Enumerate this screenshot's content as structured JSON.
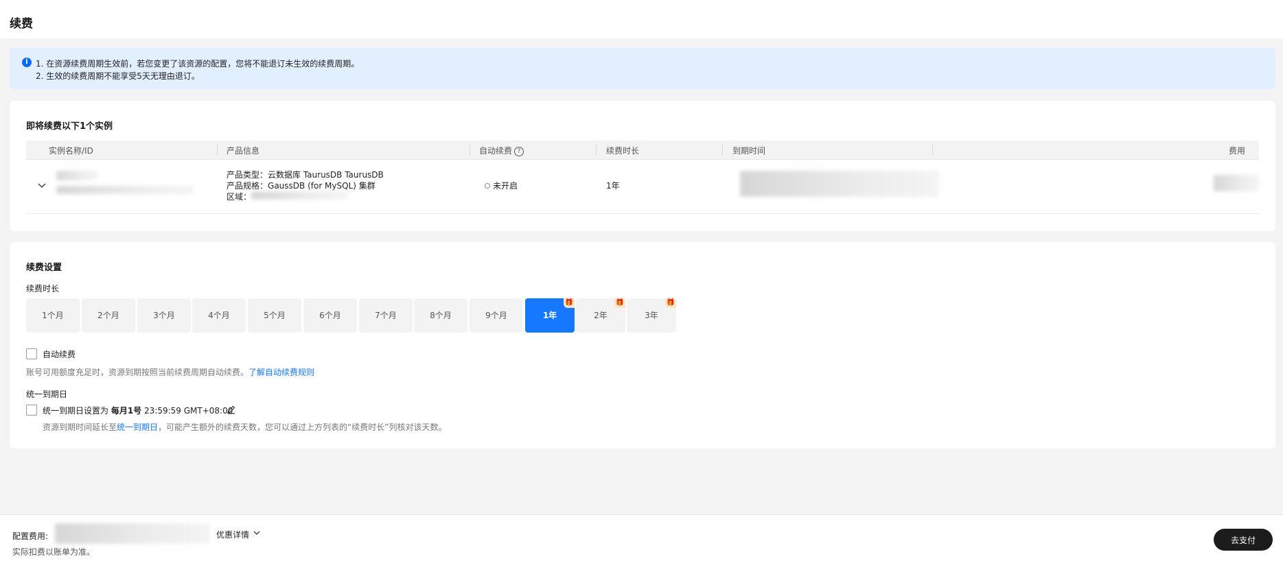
{
  "page": {
    "title": "续费"
  },
  "notice": {
    "line1": "1. 在资源续费周期生效前，若您变更了该资源的配置，您将不能退订未生效的续费周期。",
    "line2": "2. 生效的续费周期不能享受5天无理由退订。",
    "icon": "info-icon",
    "accent_color": "#0b6cf0"
  },
  "instances": {
    "title": "即将续费以下1个实例",
    "columns": [
      "实例名称/ID",
      "产品信息",
      "自动续费",
      "续费时长",
      "到期时间",
      "费用"
    ],
    "rows": [
      {
        "product_type_label": "产品类型：",
        "product_type_value": "云数据库 TaurusDB TaurusDB",
        "product_spec_label": "产品规格：",
        "product_spec_value": "GaussDB (for MySQL) 集群",
        "region_label": "区域：",
        "auto_renew": "未开启",
        "duration": "1年"
      }
    ]
  },
  "settings": {
    "title": "续费设置",
    "duration_label": "续费时长",
    "durations": [
      "1个月",
      "2个月",
      "3个月",
      "4个月",
      "5个月",
      "6个月",
      "7个月",
      "8个月",
      "9个月",
      "1年",
      "2年",
      "3年"
    ],
    "selected_duration": "1年",
    "auto_renew_label": "自动续费",
    "auto_renew_desc": "账号可用额度充足时，资源到期按照当前续费周期自动续费。",
    "auto_renew_link": "了解自动续费规则",
    "unify_title": "统一到期日",
    "unify_label_prefix": "统一到期日设置为",
    "unify_day": "每月1号",
    "unify_time": "23:59:59 GMT+08:00",
    "unify_desc_prefix": "资源到期时间延长至",
    "unify_desc_link": "统一到期日",
    "unify_desc_suffix": "，可能产生额外的续费天数，您可以通过上方列表的“续费时长”列核对该天数。",
    "accent_color": "#1677ff"
  },
  "footer": {
    "fee_label": "配置费用:",
    "discount_label": "优惠详情",
    "note": "实际扣费以账单为准。",
    "pay_button": "去支付"
  }
}
